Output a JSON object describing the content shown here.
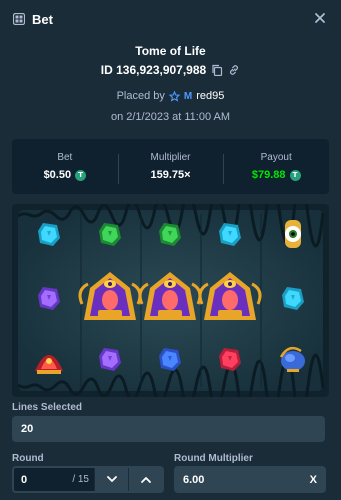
{
  "header": {
    "title": "Bet"
  },
  "bet": {
    "game": "Tome of Life",
    "id": "ID 136,923,907,988",
    "placed_by_prefix": "Placed by",
    "vip_letter": "M",
    "username": "red95",
    "date": "on 2/1/2023 at 11:00 AM"
  },
  "stats": {
    "bet_label": "Bet",
    "bet_value": "$0.50",
    "multiplier_label": "Multiplier",
    "multiplier_value": "159.75×",
    "payout_label": "Payout",
    "payout_value": "$79.88",
    "currency_glyph": "T"
  },
  "colors": {
    "payout": "#00e701",
    "coin": "#26a17b",
    "bg": "#1a2c38",
    "panel": "#0f212e"
  },
  "board": {
    "rows": [
      [
        "cyan-gem",
        "green-gem",
        "green-gem",
        "cyan-gem",
        "golden-eye"
      ],
      [
        "purple-gem",
        "pharaoh",
        "pharaoh",
        "pharaoh",
        "cyan-gem"
      ],
      [
        "red-scarab",
        "purple-gem",
        "blue-gem",
        "red-gem",
        "blue-urn"
      ]
    ]
  },
  "controls": {
    "lines_label": "Lines Selected",
    "lines_value": "20",
    "round_label": "Round",
    "round_value": "0",
    "round_total": "/ 15",
    "round_mult_label": "Round Multiplier",
    "round_mult_value": "6.00",
    "round_mult_suffix": "X"
  }
}
